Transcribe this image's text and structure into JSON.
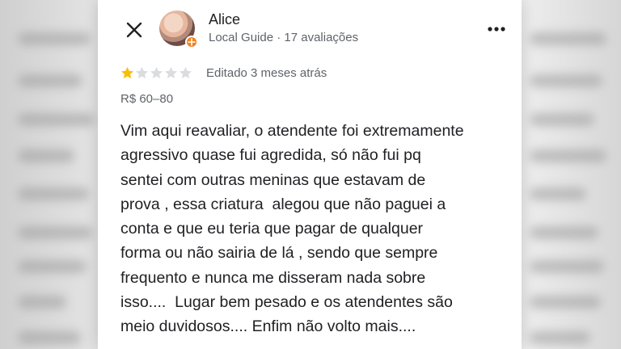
{
  "review": {
    "author_name": "Alice",
    "author_meta": "Local Guide · 17 avaliações",
    "rating": 1,
    "max_rating": 5,
    "edited_label": "Editado 3 meses atrás",
    "price_range": "R$ 60–80",
    "text_lines": [
      "Vim aqui reavaliar, o atendente foi extremamente",
      "agressivo quase fui agredida, só não fui pq",
      "sentei com outras meninas que estavam de",
      "prova , essa criatura  alegou que não paguei a",
      "conta e que eu teria que pagar de qualquer",
      "forma ou não sairia de lá , sendo que sempre",
      "frequento e nunca me disseram nada sobre",
      "isso....  Lugar bem pesado e os atendentes são",
      "meio duvidosos.... Enfim não volto mais...."
    ]
  },
  "icons": {
    "close": "close-icon",
    "more": "more-vert-icon",
    "badge": "local-guide-badge-icon",
    "star": "star-icon"
  },
  "colors": {
    "star_filled": "#fbbc04",
    "star_empty": "#dadce0",
    "badge": "#f4801f",
    "meta_text": "#5f6368"
  }
}
